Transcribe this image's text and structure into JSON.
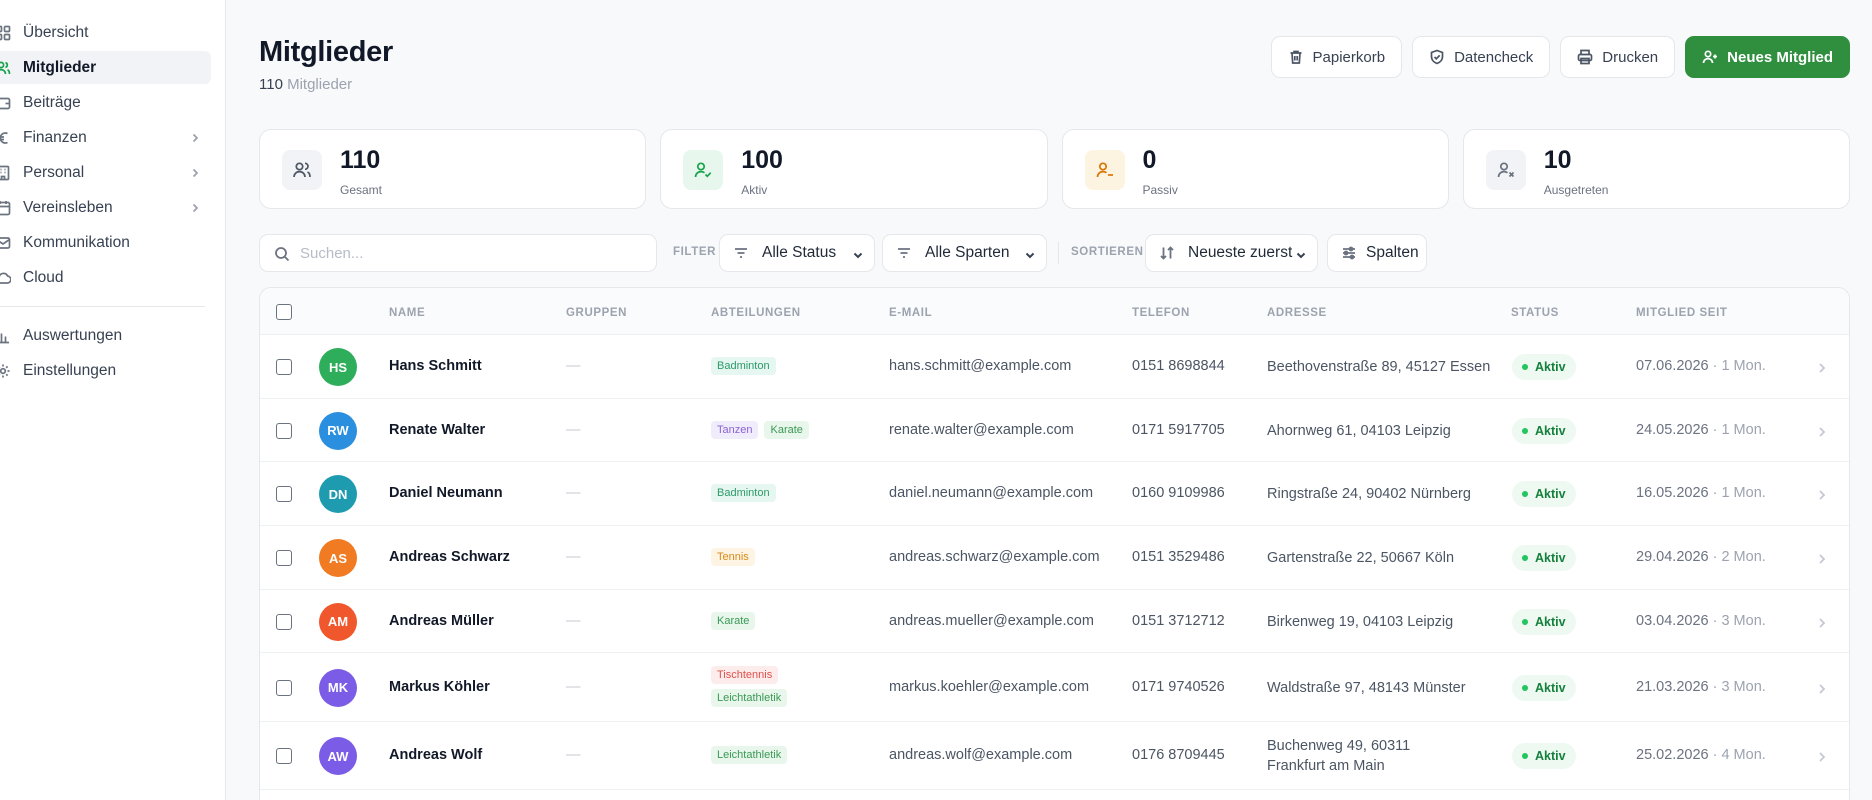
{
  "sidebar": {
    "items": [
      {
        "label": "Übersicht",
        "icon": "grid-icon"
      },
      {
        "label": "Mitglieder",
        "icon": "users-icon",
        "active": true
      },
      {
        "label": "Beiträge",
        "icon": "wallet-icon"
      },
      {
        "label": "Finanzen",
        "icon": "euro-icon",
        "chevron": true
      },
      {
        "label": "Personal",
        "icon": "building-icon",
        "chevron": true
      },
      {
        "label": "Vereinsleben",
        "icon": "calendar-icon",
        "chevron": true
      },
      {
        "label": "Kommunikation",
        "icon": "mail-icon"
      },
      {
        "label": "Cloud",
        "icon": "cloud-icon"
      }
    ],
    "secondary_items": [
      {
        "label": "Auswertungen",
        "icon": "bar-chart-icon"
      },
      {
        "label": "Einstellungen",
        "icon": "gear-icon"
      }
    ]
  },
  "header": {
    "title": "Mitglieder",
    "subtitle_count": "110",
    "subtitle_text": "Mitglieder",
    "buttons": {
      "trash": "Papierkorb",
      "datacheck": "Datencheck",
      "print": "Drucken",
      "new_member": "Neues Mitglied"
    }
  },
  "stats": [
    {
      "value": "110",
      "label": "Gesamt",
      "icon": "users-icon",
      "color": "#4b5563",
      "bg": "#f1f3f6"
    },
    {
      "value": "100",
      "label": "Aktiv",
      "icon": "user-check-icon",
      "color": "#16a34a",
      "bg": "#e8f7ed"
    },
    {
      "value": "0",
      "label": "Passiv",
      "icon": "user-minus-icon",
      "color": "#d97706",
      "bg": "#fdf3e1"
    },
    {
      "value": "10",
      "label": "Ausgetreten",
      "icon": "user-x-icon",
      "color": "#6b7280",
      "bg": "#f1f3f6"
    }
  ],
  "toolbar": {
    "search_placeholder": "Suchen...",
    "filter_label": "FILTER",
    "status_select": "Alle Status",
    "sparten_select": "Alle Sparten",
    "sort_label": "SORTIEREN",
    "sort_select": "Neueste zuerst",
    "columns_button": "Spalten"
  },
  "table": {
    "columns": [
      "NAME",
      "GRUPPEN",
      "ABTEILUNGEN",
      "E-MAIL",
      "TELEFON",
      "ADRESSE",
      "STATUS",
      "MITGLIED SEIT"
    ],
    "rows": [
      {
        "initials": "HS",
        "avatar_color": "#2eae5b",
        "name": "Hans Schmitt",
        "groups": "—",
        "tags": [
          {
            "text": "Badminton",
            "bg": "#e6f6f0",
            "fg": "#2d9a6a"
          }
        ],
        "email": "hans.schmitt@example.com",
        "phone": "0151 8698844",
        "address": "Beethovenstraße 89, 45127 Essen",
        "status": "Aktiv",
        "since": "07.06.2026",
        "since_rel": "· 1 Mon."
      },
      {
        "initials": "RW",
        "avatar_color": "#2b8fe0",
        "name": "Renate Walter",
        "groups": "—",
        "tags": [
          {
            "text": "Tanzen",
            "bg": "#f1ecfb",
            "fg": "#8b63d6"
          },
          {
            "text": "Karate",
            "bg": "#e9f6ec",
            "fg": "#3a9a55"
          }
        ],
        "email": "renate.walter@example.com",
        "phone": "0171 5917705",
        "address": "Ahornweg 61, 04103 Leipzig",
        "status": "Aktiv",
        "since": "24.05.2026",
        "since_rel": "· 1 Mon."
      },
      {
        "initials": "DN",
        "avatar_color": "#1f9bb0",
        "name": "Daniel Neumann",
        "groups": "—",
        "tags": [
          {
            "text": "Badminton",
            "bg": "#e6f6f0",
            "fg": "#2d9a6a"
          }
        ],
        "email": "daniel.neumann@example.com",
        "phone": "0160 9109986",
        "address": "Ringstraße 24, 90402 Nürnberg",
        "status": "Aktiv",
        "since": "16.05.2026",
        "since_rel": "· 1 Mon."
      },
      {
        "initials": "AS",
        "avatar_color": "#f07b22",
        "name": "Andreas Schwarz",
        "groups": "—",
        "tags": [
          {
            "text": "Tennis",
            "bg": "#fdf4e3",
            "fg": "#d98a1a"
          }
        ],
        "email": "andreas.schwarz@example.com",
        "phone": "0151 3529486",
        "address": "Gartenstraße 22, 50667 Köln",
        "status": "Aktiv",
        "since": "29.04.2026",
        "since_rel": "· 2 Mon."
      },
      {
        "initials": "AM",
        "avatar_color": "#f0572c",
        "name": "Andreas Müller",
        "groups": "—",
        "tags": [
          {
            "text": "Karate",
            "bg": "#e9f6ec",
            "fg": "#3a9a55"
          }
        ],
        "email": "andreas.mueller@example.com",
        "phone": "0151 3712712",
        "address": "Birkenweg 19, 04103 Leipzig",
        "status": "Aktiv",
        "since": "03.04.2026",
        "since_rel": "· 3 Mon."
      },
      {
        "initials": "MK",
        "avatar_color": "#7b5ce6",
        "name": "Markus Köhler",
        "groups": "—",
        "tags": [
          {
            "text": "Tischtennis",
            "bg": "#fdecec",
            "fg": "#e0504a"
          },
          {
            "text": "Leichtathletik",
            "bg": "#e9f6ec",
            "fg": "#3a9a55"
          }
        ],
        "email": "markus.koehler@example.com",
        "phone": "0171 9740526",
        "address": "Waldstraße 97, 48143 Münster",
        "status": "Aktiv",
        "since": "21.03.2026",
        "since_rel": "· 3 Mon."
      },
      {
        "initials": "AW",
        "avatar_color": "#7b5ce6",
        "name": "Andreas Wolf",
        "groups": "—",
        "tags": [
          {
            "text": "Leichtathletik",
            "bg": "#e9f6ec",
            "fg": "#3a9a55"
          }
        ],
        "email": "andreas.wolf@example.com",
        "phone": "0176 8709445",
        "address": "Buchenweg 49, 60311 Frankfurt am Main",
        "status": "Aktiv",
        "since": "25.02.2026",
        "since_rel": "· 4 Mon."
      }
    ]
  }
}
